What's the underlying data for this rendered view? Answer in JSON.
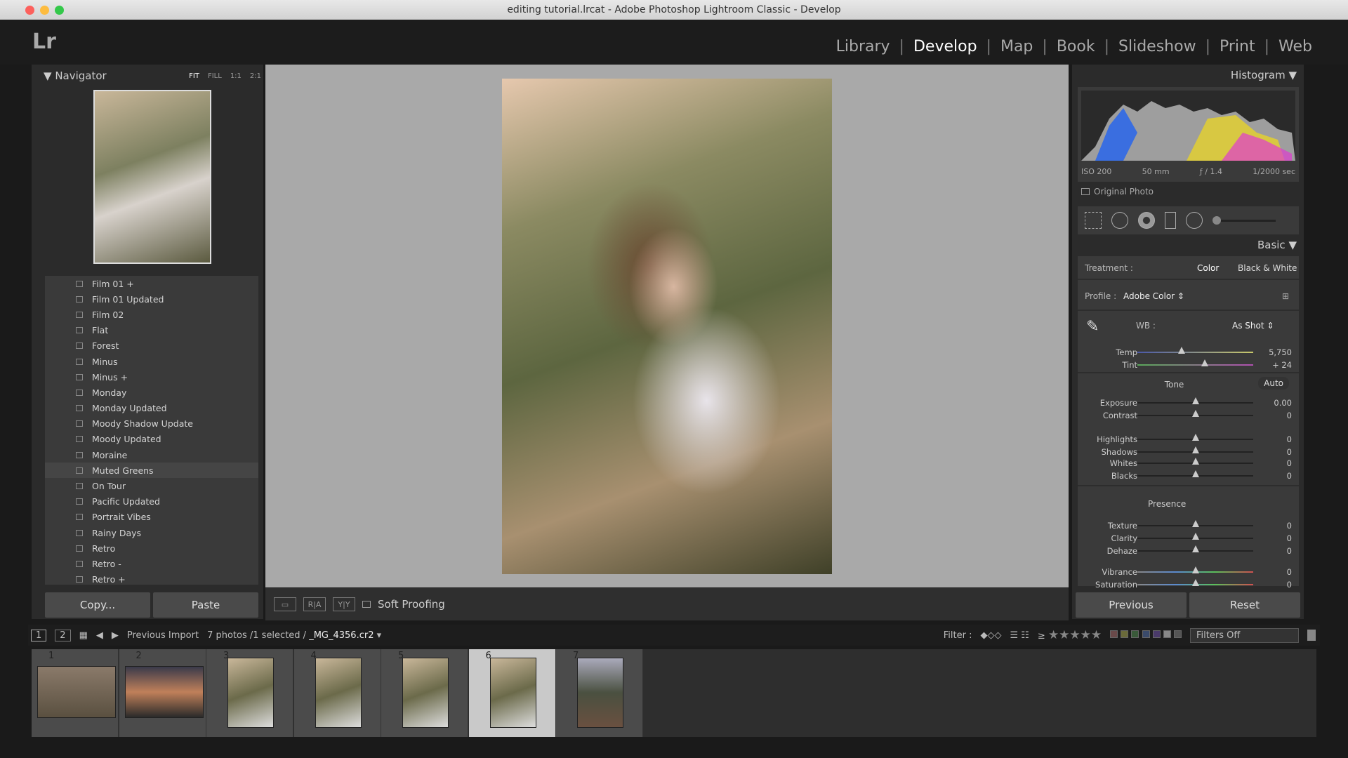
{
  "window": {
    "title": "editing tutorial.lrcat - Adobe Photoshop Lightroom Classic - Develop"
  },
  "app": {
    "logo": "Lr"
  },
  "modules": [
    {
      "label": "Library"
    },
    {
      "label": "Develop",
      "active": true
    },
    {
      "label": "Map"
    },
    {
      "label": "Book"
    },
    {
      "label": "Slideshow"
    },
    {
      "label": "Print"
    },
    {
      "label": "Web"
    }
  ],
  "navigator": {
    "title": "Navigator",
    "zoom_options": [
      "FIT",
      "FILL",
      "1:1",
      "2:1"
    ]
  },
  "presets": [
    "Film 01 +",
    "Film 01 Updated",
    "Film 02",
    "Flat",
    "Forest",
    "Minus",
    "Minus +",
    "Monday",
    "Monday Updated",
    "Moody Shadow Update",
    "Moody Updated",
    "Moraine",
    "Muted Greens",
    "On Tour",
    "Pacific Updated",
    "Portrait Vibes",
    "Rainy Days",
    "Retro",
    "Retro -",
    "Retro +"
  ],
  "hovered_preset": "Muted Greens",
  "left_buttons": {
    "copy": "Copy...",
    "paste": "Paste"
  },
  "toolbar": {
    "soft_proofing": "Soft Proofing",
    "view_a": "R|A",
    "view_b": "Y|Y"
  },
  "histogram": {
    "title": "Histogram",
    "iso": "ISO 200",
    "focal": "50 mm",
    "aperture": "ƒ / 1.4",
    "shutter": "1/2000 sec",
    "original_photo": "Original Photo"
  },
  "basic": {
    "title": "Basic",
    "treatment_label": "Treatment :",
    "color": "Color",
    "bw": "Black & White",
    "profile_label": "Profile :",
    "profile": "Adobe Color",
    "wb_label": "WB :",
    "wb": "As Shot",
    "tone": "Tone",
    "auto": "Auto",
    "presence": "Presence",
    "sliders": [
      {
        "label": "Temp",
        "value": "5,750",
        "pos": 0.38
      },
      {
        "label": "Tint",
        "value": "+ 24",
        "pos": 0.58
      },
      {
        "label": "Exposure",
        "value": "0.00",
        "pos": 0.5
      },
      {
        "label": "Contrast",
        "value": "0",
        "pos": 0.5
      },
      {
        "label": "Highlights",
        "value": "0",
        "pos": 0.5
      },
      {
        "label": "Shadows",
        "value": "0",
        "pos": 0.5
      },
      {
        "label": "Whites",
        "value": "0",
        "pos": 0.5
      },
      {
        "label": "Blacks",
        "value": "0",
        "pos": 0.5
      },
      {
        "label": "Texture",
        "value": "0",
        "pos": 0.5
      },
      {
        "label": "Clarity",
        "value": "0",
        "pos": 0.5
      },
      {
        "label": "Dehaze",
        "value": "0",
        "pos": 0.5
      },
      {
        "label": "Vibrance",
        "value": "0",
        "pos": 0.5
      },
      {
        "label": "Saturation",
        "value": "0",
        "pos": 0.5
      }
    ]
  },
  "right_buttons": {
    "previous": "Previous",
    "reset": "Reset"
  },
  "filmbar": {
    "source": "Previous Import",
    "count": "7 photos /1 selected /",
    "filename": "_MG_4356.cr2",
    "filter_label": "Filter :",
    "filters": "Filters Off",
    "page1": "1",
    "page2": "2"
  },
  "filmstrip": [
    {
      "n": "1"
    },
    {
      "n": "2"
    },
    {
      "n": "3"
    },
    {
      "n": "4"
    },
    {
      "n": "5"
    },
    {
      "n": "6",
      "selected": true
    },
    {
      "n": "7"
    }
  ],
  "colors": {
    "accent_active": "#ffffff",
    "panel": "#3a3a3a",
    "background": "#a9a9a9"
  }
}
